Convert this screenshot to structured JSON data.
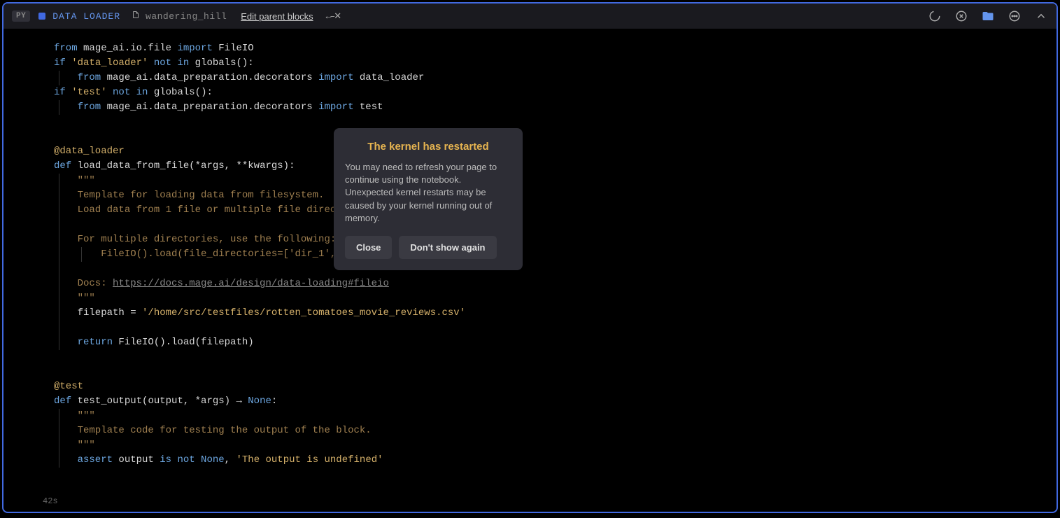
{
  "header": {
    "lang_badge": "PY",
    "block_type": "DATA LOADER",
    "block_name": "wandering_hill",
    "edit_link": "Edit parent blocks",
    "arrow_nav": "←‒✕"
  },
  "modal": {
    "title": "The kernel has restarted",
    "body": "You may need to refresh your page to continue using the notebook. Unexpected kernel restarts may be caused by your kernel running out of memory.",
    "close_label": "Close",
    "dont_show_label": "Don't show again"
  },
  "code": {
    "l1_from": "from",
    "l1_mod": " mage_ai.io.file ",
    "l1_import": "import",
    "l1_name": " FileIO",
    "l2_if": "if",
    "l2_str": " 'data_loader' ",
    "l2_not": "not in",
    "l2_glob": " globals():",
    "l3_from": "    from",
    "l3_mod": " mage_ai.data_preparation.decorators ",
    "l3_import": "import",
    "l3_name": " data_loader",
    "l4_if": "if",
    "l4_str": " 'test' ",
    "l4_not": "not in",
    "l4_glob": " globals():",
    "l5_from": "    from",
    "l5_mod": " mage_ai.data_preparation.decorators ",
    "l5_import": "import",
    "l5_name": " test",
    "l7_dec": "@data_loader",
    "l8_def": "def",
    "l8_fn": " load_data_from_file",
    "l8_sig": "(*args, **kwargs):",
    "l9_doc": "    \"\"\"",
    "l10": "    Template for loading data from filesystem.",
    "l11": "    Load data from 1 file or multiple file directories.",
    "l13": "    For multiple directories, use the following:",
    "l14": "        FileIO().load(file_directories=['dir_1', 'dir_2'])",
    "l16a": "    Docs: ",
    "l16b": "https://docs.mage.ai/design/data-loading#fileio",
    "l17_doc": "    \"\"\"",
    "l18_var": "    filepath = ",
    "l18_str": "'/home/src/testfiles/rotten_tomatoes_movie_reviews.csv'",
    "l20_ret": "    return",
    "l20_code": " FileIO().load(filepath)",
    "l23_dec": "@test",
    "l24_def": "def",
    "l24_fn": " test_output",
    "l24_sig": "(output, *args) ",
    "l24_arrow": "→",
    "l24_none": " None",
    "l24_colon": ":",
    "l25_doc": "    \"\"\"",
    "l26": "    Template code for testing the output of the block.",
    "l27_doc": "    \"\"\"",
    "l28_assert": "    assert",
    "l28_out": " output ",
    "l28_isnot": "is not",
    "l28_none": " None",
    "l28_comma": ", ",
    "l28_str": "'The output is undefined'"
  },
  "footer": {
    "time": "42s"
  }
}
